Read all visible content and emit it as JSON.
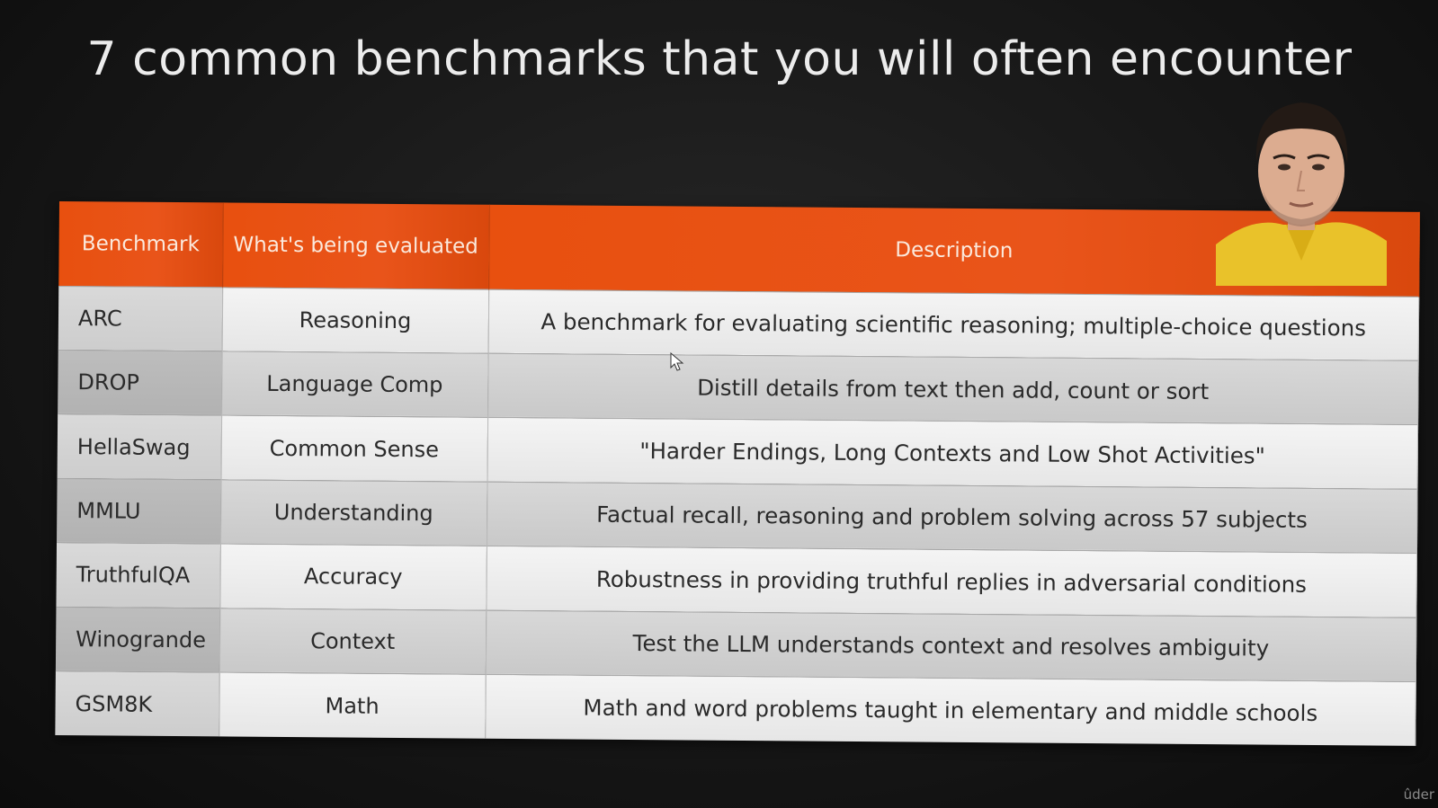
{
  "slide": {
    "title": "7 common benchmarks that you will often encounter"
  },
  "table": {
    "headers": [
      "Benchmark",
      "What's being evaluated",
      "Description"
    ],
    "rows": [
      {
        "benchmark": "ARC",
        "evaluated": "Reasoning",
        "description": "A benchmark for evaluating scientific reasoning; multiple-choice questions"
      },
      {
        "benchmark": "DROP",
        "evaluated": "Language Comp",
        "description": "Distill details from text then add, count or sort"
      },
      {
        "benchmark": "HellaSwag",
        "evaluated": "Common Sense",
        "description": "\"Harder Endings, Long Contexts and Low Shot Activities\""
      },
      {
        "benchmark": "MMLU",
        "evaluated": "Understanding",
        "description": "Factual recall, reasoning and problem solving across 57 subjects"
      },
      {
        "benchmark": "TruthfulQA",
        "evaluated": "Accuracy",
        "description": "Robustness in providing truthful replies in adversarial conditions"
      },
      {
        "benchmark": "Winogrande",
        "evaluated": "Context",
        "description": "Test the LLM understands context and resolves ambiguity"
      },
      {
        "benchmark": "GSM8K",
        "evaluated": "Math",
        "description": "Math and word problems taught in elementary and middle schools"
      }
    ]
  },
  "colors": {
    "header_orange": "#e8500f",
    "header_text": "#fbe9dc",
    "title_text": "#ececec"
  },
  "watermark": "ûder"
}
